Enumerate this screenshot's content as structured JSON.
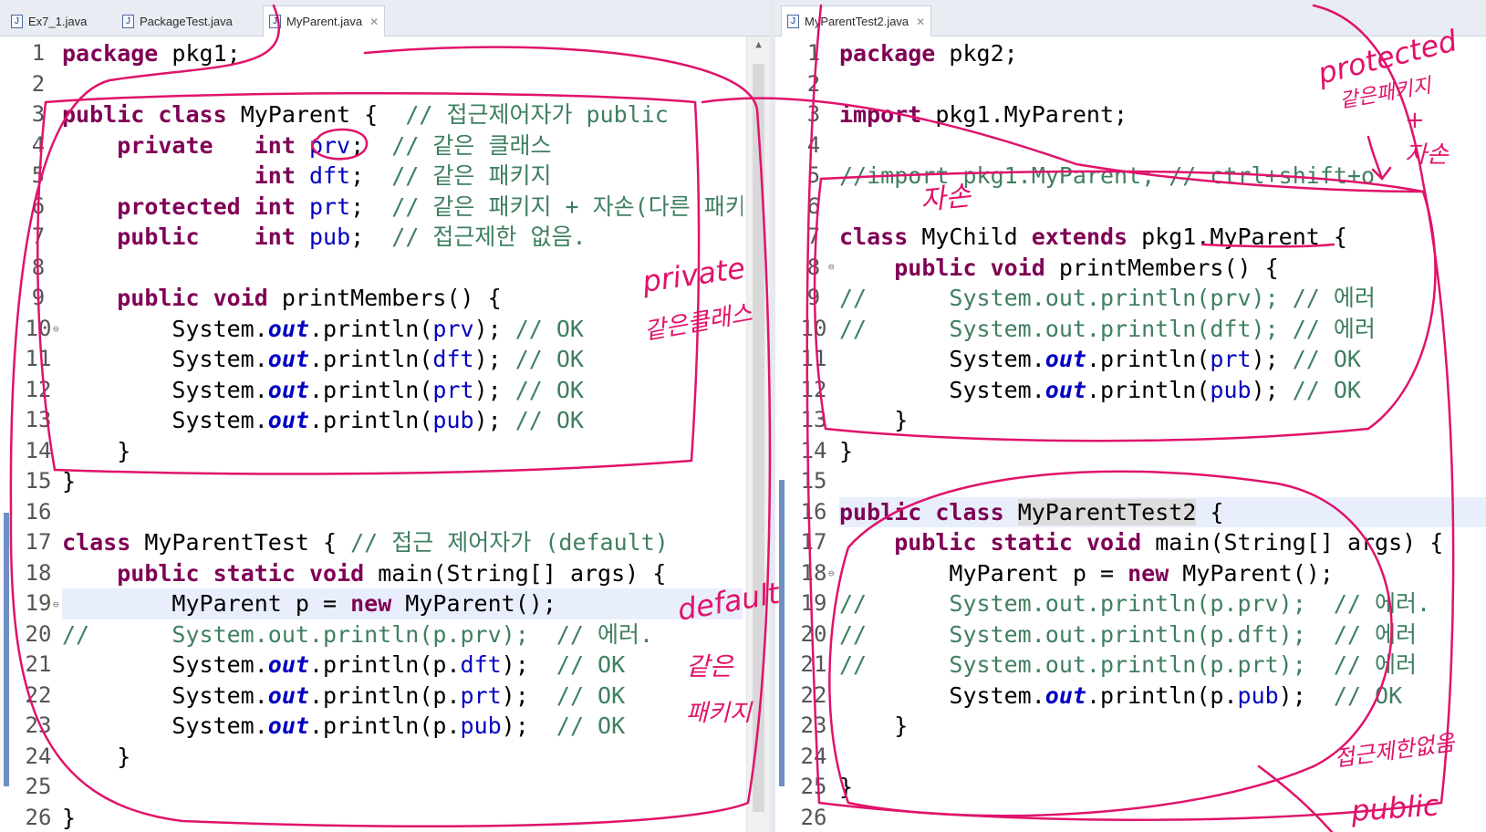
{
  "left_pane": {
    "tabs": [
      {
        "label": "Ex7_1.java",
        "active": false
      },
      {
        "label": "PackageTest.java",
        "active": false
      },
      {
        "label": "MyParent.java",
        "active": true
      }
    ],
    "lines": [
      {
        "no": "1"
      },
      {
        "no": "2"
      },
      {
        "no": "3"
      },
      {
        "no": "4"
      },
      {
        "no": "5"
      },
      {
        "no": "6"
      },
      {
        "no": "7"
      },
      {
        "no": "8"
      },
      {
        "no": "9"
      },
      {
        "no": "10"
      },
      {
        "no": "11"
      },
      {
        "no": "12"
      },
      {
        "no": "13"
      },
      {
        "no": "14"
      },
      {
        "no": "15"
      },
      {
        "no": "16"
      },
      {
        "no": "17"
      },
      {
        "no": "18"
      },
      {
        "no": "19"
      },
      {
        "no": "20"
      },
      {
        "no": "21"
      },
      {
        "no": "22"
      },
      {
        "no": "23"
      },
      {
        "no": "24"
      },
      {
        "no": "25"
      },
      {
        "no": "26"
      }
    ],
    "code": {
      "l1": {
        "kw": "package",
        "rest": " pkg1;"
      },
      "l3": {
        "kw1": "public",
        "kw2": "class",
        "name": " MyParent {  ",
        "comment": "// 접근제어자가 public"
      },
      "l4": {
        "kw": "private",
        "type": "int",
        "field": "prv",
        "semi": ";  ",
        "comment": "// 같은 클래스"
      },
      "l5": {
        "type": "int",
        "field": "dft",
        "semi": ";  ",
        "comment": "// 같은 패키지"
      },
      "l6": {
        "kw": "protected",
        "type": "int",
        "field": "prt",
        "semi": ";  ",
        "comment": "// 같은 패키지 + 자손(다른 패키"
      },
      "l7": {
        "kw": "public",
        "type": "int",
        "field": "pub",
        "semi": ";  ",
        "comment": "// 접근제한 없음."
      },
      "l9": {
        "kw1": "public",
        "kw2": "void",
        "rest": " printMembers() {"
      },
      "l10": {
        "a": "System.",
        "out": "out",
        "b": ".println(",
        "field": "prv",
        "c": "); ",
        "comment": "// OK"
      },
      "l11": {
        "a": "System.",
        "out": "out",
        "b": ".println(",
        "field": "dft",
        "c": "); ",
        "comment": "// OK"
      },
      "l12": {
        "a": "System.",
        "out": "out",
        "b": ".println(",
        "field": "prt",
        "c": "); ",
        "comment": "// OK"
      },
      "l13": {
        "a": "System.",
        "out": "out",
        "b": ".println(",
        "field": "pub",
        "c": "); ",
        "comment": "// OK"
      },
      "l14": "}",
      "l15": "}",
      "l17": {
        "kw": "class",
        "name": " MyParentTest { ",
        "comment": "// 접근 제어자가 (default)"
      },
      "l18": {
        "kw1": "public",
        "kw2": "static",
        "kw3": "void",
        "rest": " main(String[] args) {"
      },
      "l19": {
        "a": "MyParent p = ",
        "kw": "new",
        "b": " MyParent();"
      },
      "l20": {
        "comment": "//      System.out.println(p.prv);  // 에러."
      },
      "l21": {
        "a": "System.",
        "out": "out",
        "b": ".println(p.",
        "field": "dft",
        "c": ");  ",
        "comment": "// OK"
      },
      "l22": {
        "a": "System.",
        "out": "out",
        "b": ".println(p.",
        "field": "prt",
        "c": ");  ",
        "comment": "// OK"
      },
      "l23": {
        "a": "System.",
        "out": "out",
        "b": ".println(p.",
        "field": "pub",
        "c": ");  ",
        "comment": "// OK"
      },
      "l24": "}",
      "l26": "}"
    }
  },
  "right_pane": {
    "tabs": [
      {
        "label": "MyParentTest2.java",
        "active": true
      }
    ],
    "lines": [
      {
        "no": "1"
      },
      {
        "no": "2"
      },
      {
        "no": "3"
      },
      {
        "no": "4"
      },
      {
        "no": "5"
      },
      {
        "no": "6"
      },
      {
        "no": "7"
      },
      {
        "no": "8"
      },
      {
        "no": "9"
      },
      {
        "no": "10"
      },
      {
        "no": "11"
      },
      {
        "no": "12"
      },
      {
        "no": "13"
      },
      {
        "no": "14"
      },
      {
        "no": "15"
      },
      {
        "no": "16"
      },
      {
        "no": "17"
      },
      {
        "no": "18"
      },
      {
        "no": "19"
      },
      {
        "no": "20"
      },
      {
        "no": "21"
      },
      {
        "no": "22"
      },
      {
        "no": "23"
      },
      {
        "no": "24"
      },
      {
        "no": "25"
      },
      {
        "no": "26"
      }
    ],
    "code": {
      "l1": {
        "kw": "package",
        "rest": " pkg2;"
      },
      "l3": {
        "kw": "import",
        "rest": " pkg1.MyParent;"
      },
      "l5": {
        "comment": "//import pkg1.MyParent; // ctrl+shift+o"
      },
      "l7": {
        "kw1": "class",
        "name": " MyChild ",
        "kw2": "extends",
        "rest": " pkg1.MyParent {"
      },
      "l8": {
        "kw1": "public",
        "kw2": "void",
        "rest": " printMembers() {"
      },
      "l9": {
        "comment": "//      System.out.println(prv); // 에러"
      },
      "l10": {
        "comment": "//      System.out.println(dft); // 에러"
      },
      "l11": {
        "a": "System.",
        "out": "out",
        "b": ".println(",
        "field": "prt",
        "c": "); ",
        "comment": "// OK"
      },
      "l12": {
        "a": "System.",
        "out": "out",
        "b": ".println(",
        "field": "pub",
        "c": "); ",
        "comment": "// OK"
      },
      "l13": "}",
      "l14": "}",
      "l16": {
        "kw1": "public",
        "kw2": "class",
        "name": "MyParentTest2",
        "rest": " {"
      },
      "l17": {
        "kw1": "public",
        "kw2": "static",
        "kw3": "void",
        "rest": " main(String[] args) {"
      },
      "l18": {
        "a": "MyParent p = ",
        "kw": "new",
        "b": " MyParent();"
      },
      "l19": {
        "comment": "//      System.out.println(p.prv);  // 에러."
      },
      "l20": {
        "comment": "//      System.out.println(p.dft);  // 에러"
      },
      "l21": {
        "comment": "//      System.out.println(p.prt);  // 에러"
      },
      "l22": {
        "a": "System.",
        "out": "out",
        "b": ".println(p.",
        "field": "pub",
        "c": ");  ",
        "comment": "// OK"
      },
      "l23": "}",
      "l25": "}"
    }
  },
  "annotations": {
    "private_note_1": "private",
    "private_note_2": "같은클래스",
    "default_note_1": "default",
    "default_note_2": "같은",
    "default_note_3": "패키지",
    "child_note": "자손",
    "protected_note_1": "protected",
    "protected_note_2": "같은패키지",
    "protected_note_3": "+",
    "protected_note_4": "자손",
    "public_note_1": "접근제한없음",
    "public_note_2": "public",
    "ink_color": "#e0136b"
  }
}
